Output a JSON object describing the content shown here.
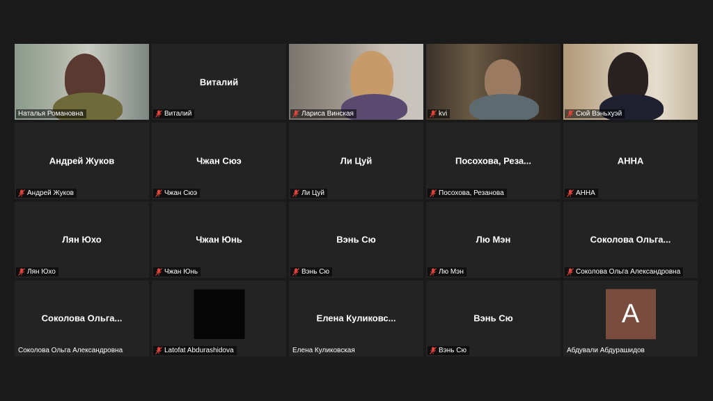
{
  "participants": [
    {
      "tile_name": "",
      "label": "Наталья Романовна",
      "muted": false,
      "video": true,
      "active": true
    },
    {
      "tile_name": "Виталий",
      "label": "Виталий",
      "muted": true
    },
    {
      "tile_name": "",
      "label": "Лариса Винская",
      "muted": true,
      "video": true
    },
    {
      "tile_name": "",
      "label": "kvi",
      "muted": true,
      "video": true
    },
    {
      "tile_name": "",
      "label": "Сюй Вэньхуэй",
      "muted": true,
      "video": true
    },
    {
      "tile_name": "Андрей Жуков",
      "label": "Андрей Жуков",
      "muted": true
    },
    {
      "tile_name": "Чжан Сюэ",
      "label": "Чжан Сюэ",
      "muted": true
    },
    {
      "tile_name": "Ли Цуй",
      "label": "Ли Цуй",
      "muted": true
    },
    {
      "tile_name": "Посохова,  Реза...",
      "label": "Посохова, Резанова",
      "muted": true
    },
    {
      "tile_name": "АННА",
      "label": "АННА",
      "muted": true
    },
    {
      "tile_name": "Лян Юхо",
      "label": "Лян Юхо",
      "muted": true
    },
    {
      "tile_name": "Чжан Юнь",
      "label": "Чжан Юнь",
      "muted": true
    },
    {
      "tile_name": "Вэнь Сю",
      "label": "Вэнь Сю",
      "muted": true
    },
    {
      "tile_name": "Лю Мэн",
      "label": "Лю Мэн",
      "muted": true
    },
    {
      "tile_name": "Соколова  Ольга...",
      "label": "Соколова Ольга Александровна",
      "muted": true
    },
    {
      "tile_name": "Соколова  Ольга...",
      "label": "Соколова Ольга Александровна",
      "muted": false
    },
    {
      "tile_name": "",
      "label": "Latofat Abdurashidova",
      "muted": true,
      "black_video": true
    },
    {
      "tile_name": "Елена  Куликовс...",
      "label": "Елена Куликовская",
      "muted": false
    },
    {
      "tile_name": "Вэнь Сю",
      "label": "Вэнь Сю",
      "muted": true
    },
    {
      "tile_name": "",
      "label": "Абдували Абдурашидов",
      "muted": false,
      "avatar_letter": "A"
    }
  ],
  "colors": {
    "background": "#1a1a1a",
    "tile": "#232323",
    "active_border": "#c8e06a",
    "muted_mic": "#e0443a",
    "avatar": "#7a4c3e"
  }
}
